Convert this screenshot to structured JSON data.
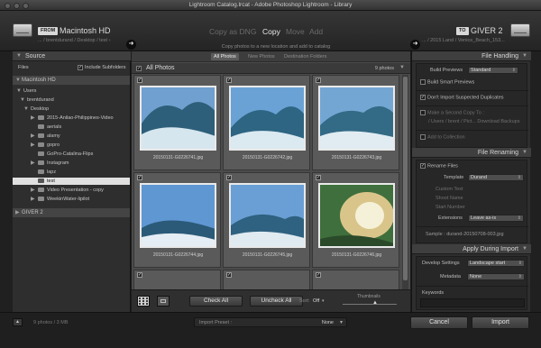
{
  "window": {
    "title": "Lightroom Catalog.lrcat - Adobe Photoshop Lightroom - Library"
  },
  "header": {
    "from_tag": "FROM",
    "source_name": "Macintosh HD",
    "source_path": "... / brentdurand / Desktop / test ›",
    "modes": [
      "Copy as DNG",
      "Copy",
      "Move",
      "Add"
    ],
    "mode_description": "Copy photos to a new location and add to catalog",
    "to_tag": "TO",
    "dest_name": "GIVER 2",
    "dest_path": "... / 2015 Land / Venice_Beach_153..."
  },
  "source_panel": {
    "title": "Source",
    "files_label": "Files",
    "include_subfolders": "Include Subfolders",
    "drive": "Macintosh HD",
    "tree": [
      "Users",
      "brentdurand",
      "Desktop",
      "2015-Anilao-Philippines-Video",
      "aerials",
      "alamy",
      "gopro",
      "GoPro-Catalina-Flips",
      "Instagram",
      "lapz",
      "test",
      "Video Presentation - copy",
      "WeekinWater-lipilot"
    ],
    "drive2": "GIVER 2"
  },
  "view_tabs": [
    "All Photos",
    "New Photos",
    "Destination Folders"
  ],
  "grid": {
    "title": "All Photos",
    "count": "9 photos",
    "files": [
      "20150131-G0226741.jpg",
      "20150131-G0226742.jpg",
      "20150131-G0226743.jpg",
      "20150131-G0226744.jpg",
      "20150131-G0226745.jpg",
      "20150131-G0226746.jpg"
    ]
  },
  "center_bottom": {
    "check_all": "Check All",
    "uncheck_all": "Uncheck All",
    "sort_label": "Sort:",
    "sort_value": "Off",
    "thumbnails_label": "Thumbnails"
  },
  "file_handling": {
    "title": "File Handling",
    "build_previews_label": "Build Previews",
    "build_previews_value": "Standard",
    "build_smart_previews": "Build Smart Previews",
    "dont_import_duplicates": "Don't Import Suspected Duplicates",
    "make_second_copy": "Make a Second Copy To :",
    "second_copy_path": "/ Users / brent / Pict... Download Backups",
    "add_to_collection": "Add to Collection"
  },
  "file_renaming": {
    "title": "File Renaming",
    "rename_files": "Rename Files",
    "template_label": "Template",
    "template_value": "Durand",
    "custom_text": "Custom Text",
    "shoot_name": "Shoot Name",
    "start_number": "Start Number",
    "extensions_label": "Extensions",
    "extensions_value": "Leave as-is",
    "sample": "Sample : durand-20150708-003.jpg"
  },
  "apply_during_import": {
    "title": "Apply During Import",
    "develop_label": "Develop Settings",
    "develop_value": "Landscape start",
    "metadata_label": "Metadata",
    "metadata_value": "None",
    "keywords_label": "Keywords"
  },
  "footer": {
    "summary": "9 photos / 3 MB",
    "import_preset_label": "Import Preset :",
    "import_preset_value": "None",
    "cancel": "Cancel",
    "import": "Import"
  }
}
